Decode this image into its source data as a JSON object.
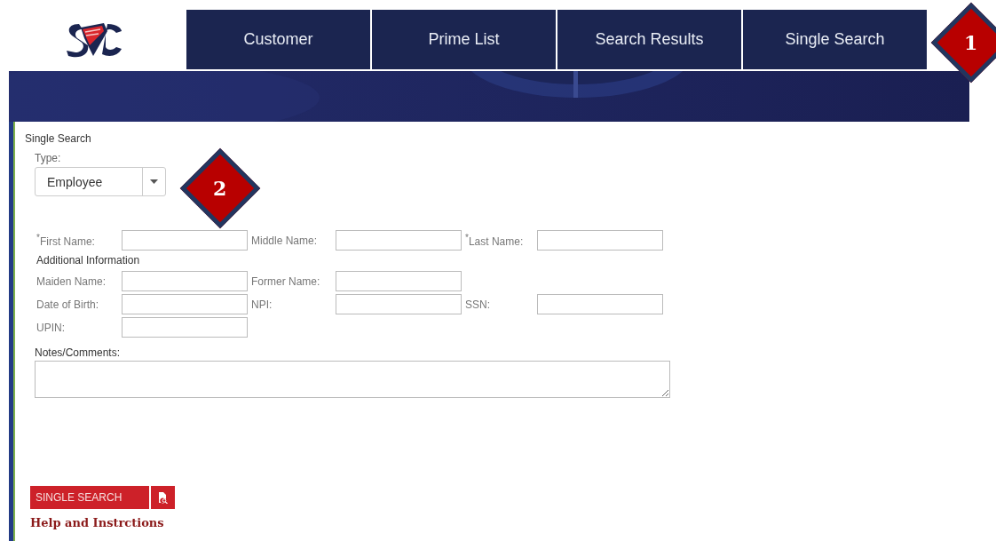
{
  "nav": {
    "tabs": [
      "Customer",
      "Prime List",
      "Search Results",
      "Single Search"
    ]
  },
  "banner": {
    "kind": "picture"
  },
  "panel": {
    "title": "Single Search",
    "type_select": {
      "label": "Type:",
      "value": "Employee"
    },
    "name_fields": [
      {
        "label": "$^{*}$First Name:"
      },
      {
        "label": "Middle Name:"
      },
      {
        "label": "$^{*}$Last Name:"
      }
    ],
    "additional_heading": "Additional Information",
    "additional_rows": [
      [
        {
          "label": "Maiden Name:"
        },
        {
          "label": "Former Name:"
        }
      ],
      [
        {
          "label": "Date of Birth:"
        },
        {
          "label": "NPI:"
        },
        {
          "label": "SSN:"
        }
      ],
      [
        {
          "label": "UPIN:"
        }
      ]
    ],
    "notes_label": "Notes/Comments:",
    "search_button": "SINGLE SEARCH",
    "help_link": "Help and Instrctions"
  },
  "callouts": [
    "1",
    "2"
  ]
}
